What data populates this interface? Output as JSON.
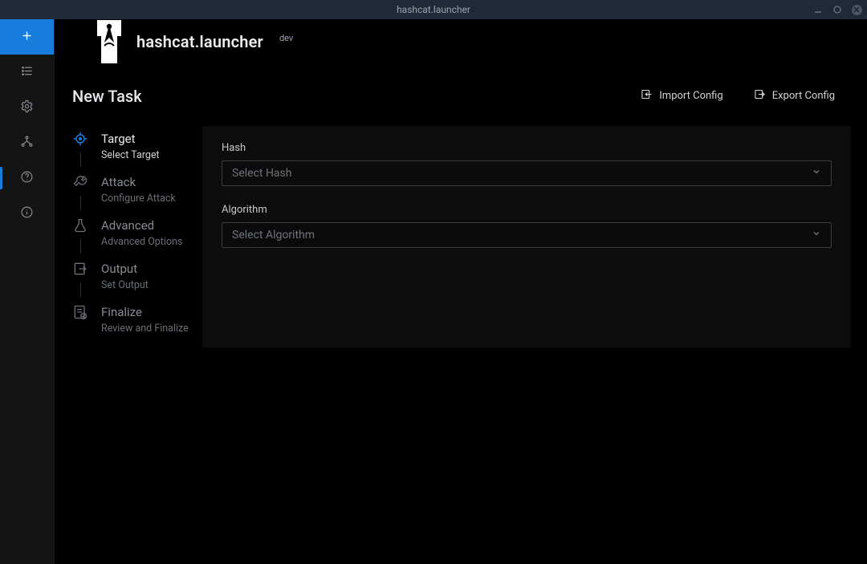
{
  "window": {
    "title": "hashcat.launcher"
  },
  "brand": {
    "title": "hashcat.launcher",
    "badge": "dev"
  },
  "rail": {
    "new_label": "New",
    "items": [
      "tasks",
      "settings",
      "nodes",
      "help",
      "info"
    ]
  },
  "page": {
    "title": "New Task",
    "import_label": "Import Config",
    "export_label": "Export Config"
  },
  "steps": [
    {
      "title": "Target",
      "sub": "Select Target",
      "icon": "crosshair",
      "active": true
    },
    {
      "title": "Attack",
      "sub": "Configure Attack",
      "icon": "wrench",
      "active": false
    },
    {
      "title": "Advanced",
      "sub": "Advanced Options",
      "icon": "flask",
      "active": false
    },
    {
      "title": "Output",
      "sub": "Set Output",
      "icon": "export",
      "active": false
    },
    {
      "title": "Finalize",
      "sub": "Review and Finalize",
      "icon": "checklist",
      "active": false
    }
  ],
  "form": {
    "hash": {
      "label": "Hash",
      "placeholder": "Select Hash"
    },
    "algorithm": {
      "label": "Algorithm",
      "placeholder": "Select Algorithm"
    }
  },
  "colors": {
    "accent": "#177ddc"
  }
}
